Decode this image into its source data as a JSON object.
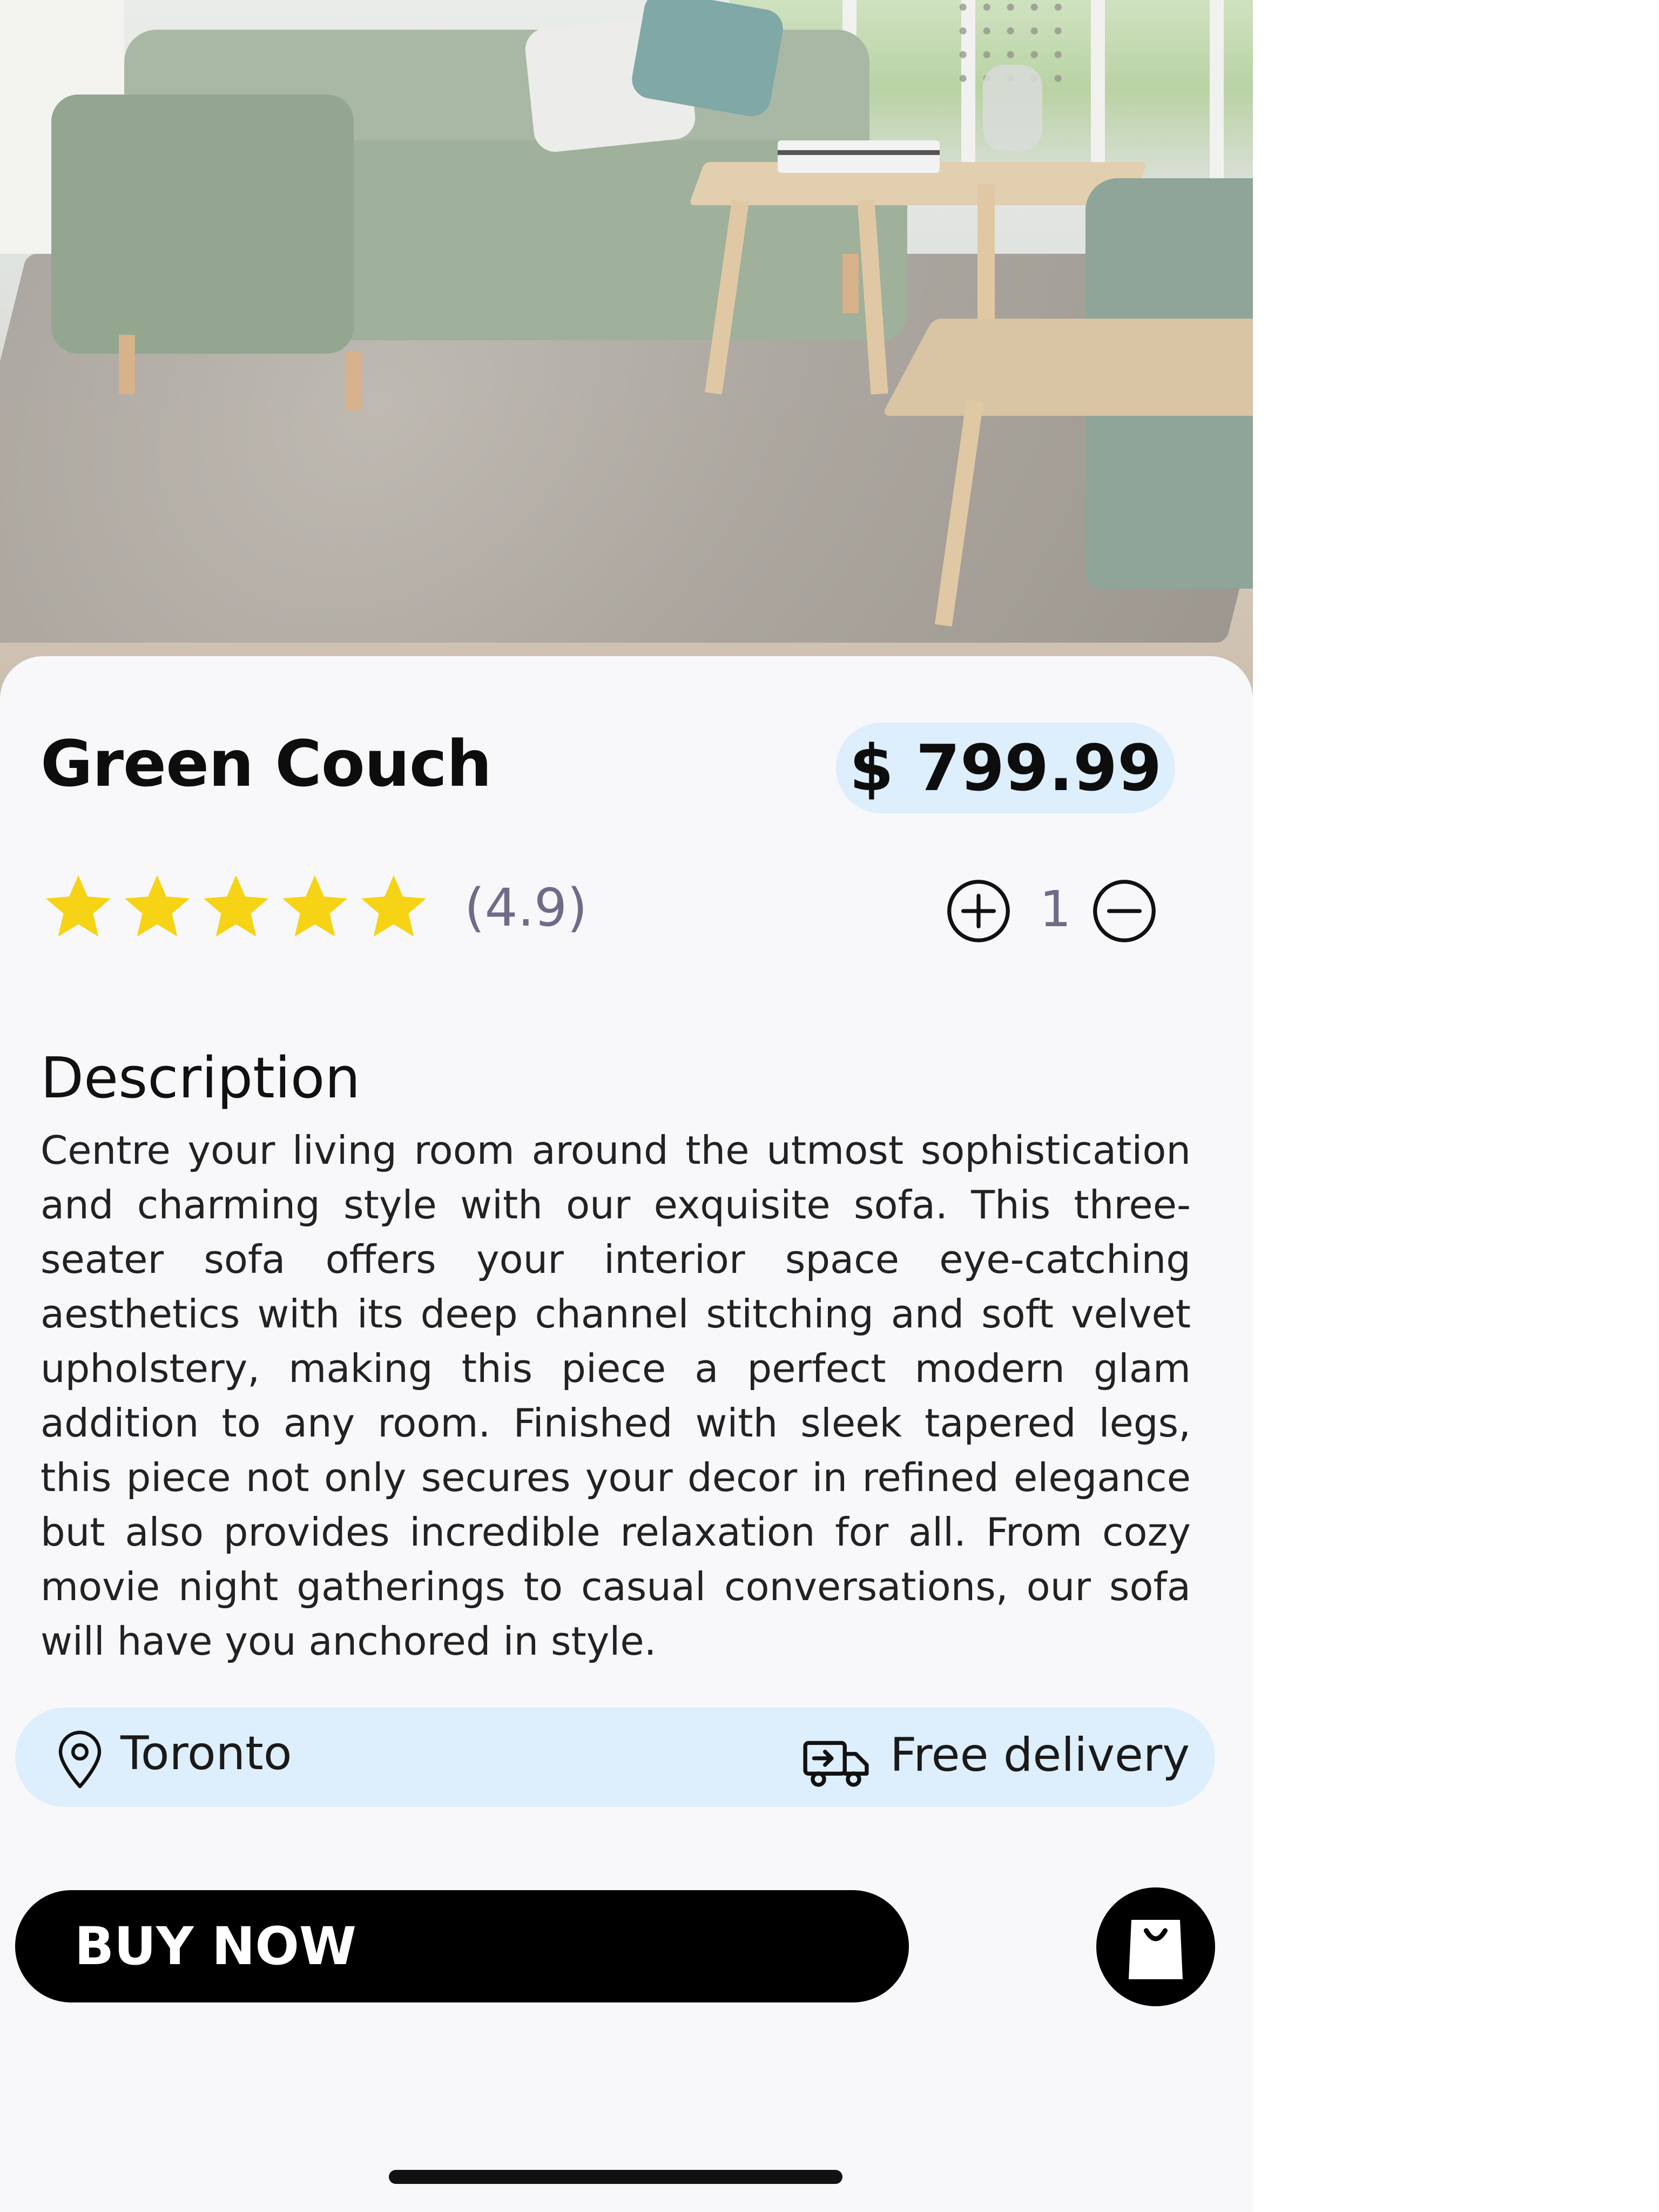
{
  "product": {
    "name": "Green Couch",
    "price": "$ 799.99",
    "rating_text": "(4.9)",
    "rating_stars": 5,
    "quantity": "1"
  },
  "description": {
    "heading": "Description",
    "body": "Centre your living room around the utmost sophistication and charming style with our exquisite sofa. This three-seater sofa offers your interior space eye-catching aesthetics with its deep channel stitching and soft velvet upholstery, making this piece a perfect modern glam addition to any room. Finished with sleek tapered legs, this piece not only secures your decor in refined elegance but also provides incredible relaxation for all. From cozy movie night gatherings to casual conversations, our sofa will have you anchored in style."
  },
  "info": {
    "location": "Toronto",
    "delivery": "Free delivery"
  },
  "actions": {
    "buy_label": "BUY NOW"
  },
  "icons": {
    "location": "location-pin-icon",
    "delivery": "delivery-truck-icon",
    "cart": "shopping-bag-icon",
    "qty_plus": "plus-circle-icon",
    "qty_minus": "minus-circle-icon",
    "star": "star-icon"
  },
  "colors": {
    "accent_pill": "#ddeefc",
    "star": "#f6d314",
    "muted_text": "#6f6c88",
    "button": "#000000"
  }
}
